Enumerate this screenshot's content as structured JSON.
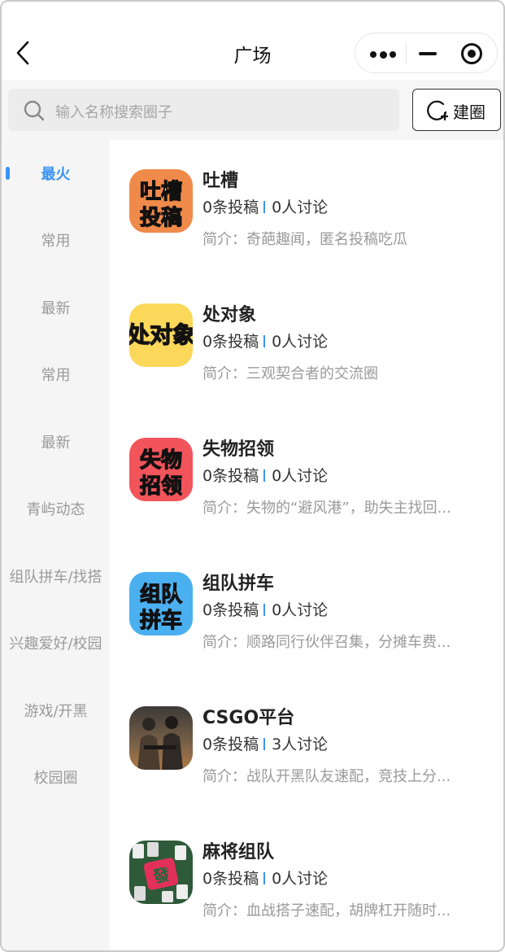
{
  "header": {
    "title": "广场",
    "back_icon": "chevron-left-icon",
    "capsule": {
      "more_icon": "more-dots-icon",
      "minimize_icon": "minimize-icon",
      "close_icon": "target-circle-icon"
    }
  },
  "search": {
    "placeholder": "输入名称搜索圈子",
    "create_label": "建圈"
  },
  "sidebar": {
    "items": [
      {
        "label": "最火",
        "active": true
      },
      {
        "label": "常用"
      },
      {
        "label": "最新"
      },
      {
        "label": "常用"
      },
      {
        "label": "最新"
      },
      {
        "label": "青屿动态"
      },
      {
        "label": "组队拼车/找搭"
      },
      {
        "label": "兴趣爱好/校园"
      },
      {
        "label": "游戏/开黑"
      },
      {
        "label": "校园圈"
      }
    ]
  },
  "circles": [
    {
      "name": "吐槽",
      "posts": "0条投稿",
      "discussions": "0人讨论",
      "desc": "简介：奇葩趣闻，匿名投稿吃瓜",
      "avatar_text": [
        "吐槽",
        "投稿"
      ],
      "avatar_color": "#f08a4b"
    },
    {
      "name": "处对象",
      "posts": "0条投稿",
      "discussions": "0人讨论",
      "desc": "简介：三观契合者的交流圈",
      "avatar_text": [
        "处对象"
      ],
      "avatar_color": "#fbd85a"
    },
    {
      "name": "失物招领",
      "posts": "0条投稿",
      "discussions": "0人讨论",
      "desc": "简介：失物的“避风港”，助失主找回...",
      "avatar_text": [
        "失物",
        "招领"
      ],
      "avatar_color": "#f2545b"
    },
    {
      "name": "组队拼车",
      "posts": "0条投稿",
      "discussions": "0人讨论",
      "desc": "简介：顺路同行伙伴召集，分摊车费...",
      "avatar_text": [
        "组队",
        "拼车"
      ],
      "avatar_color": "#4bb0f0"
    },
    {
      "name": "CSGO平台",
      "posts": "0条投稿",
      "discussions": "3人讨论",
      "desc": "简介：战队开黑队友速配，竞技上分...",
      "avatar_text": [],
      "avatar_color": "#6b5a49"
    },
    {
      "name": "麻将组队",
      "posts": "0条投稿",
      "discussions": "0人讨论",
      "desc": "简介：血战搭子速配，胡牌杠开随时...",
      "avatar_text": [
        "發"
      ],
      "avatar_color": "#2f5a3a"
    }
  ]
}
